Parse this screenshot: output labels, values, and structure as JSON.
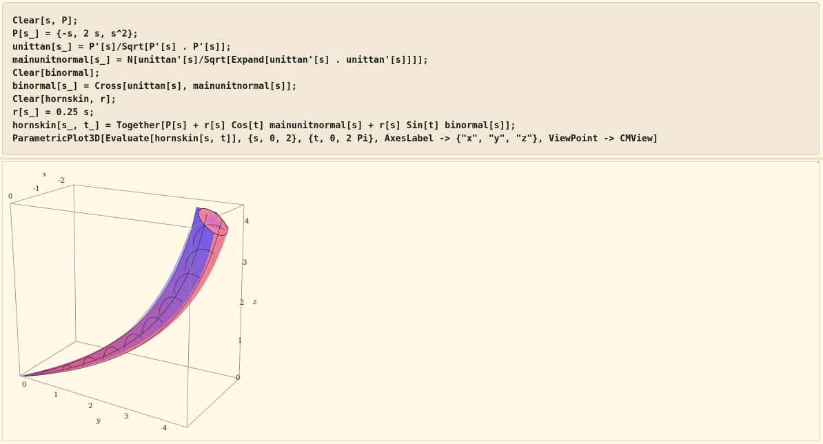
{
  "input_cell": {
    "lines": [
      "Clear[s, P];",
      "P[s_] = {-s, 2 s, s^2};",
      "unittan[s_] = P'[s]/Sqrt[P'[s] . P'[s]];",
      "mainunitnormal[s_] = N[unittan'[s]/Sqrt[Expand[unittan'[s] . unittan'[s]]]];",
      "Clear[binormal];",
      "binormal[s_] = Cross[unittan[s], mainunitnormal[s]];",
      "Clear[hornskin, r];",
      "r[s_] = 0.25 s;",
      "hornskin[s_, t_] = Together[P[s] + r[s] Cos[t] mainunitnormal[s] + r[s] Sin[t] binormal[s]];",
      "ParametricPlot3D[Evaluate[hornskin[s, t]], {s, 0, 2}, {t, 0, 2 Pi}, AxesLabel -> {\"x\", \"y\", \"z\"}, ViewPoint -> CMView]"
    ]
  },
  "plot": {
    "axis_labels": {
      "x": "x",
      "y": "y",
      "z": "z"
    },
    "x_ticks": [
      "-2",
      "-1",
      "0"
    ],
    "y_ticks": [
      "0",
      "1",
      "2",
      "3",
      "4"
    ],
    "z_ticks": [
      "0",
      "1",
      "2",
      "3",
      "4"
    ],
    "colors": {
      "surface_red": "#e8607c",
      "surface_blue": "#6a5df0",
      "mesh": "#1a1a1a",
      "box": "#7a7a7a"
    }
  }
}
